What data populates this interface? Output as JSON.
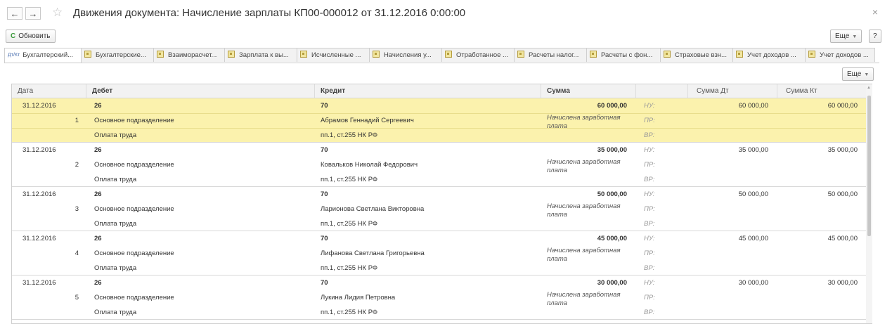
{
  "header": {
    "title": "Движения документа: Начисление зарплаты КП00-000012 от 31.12.2016 0:00:00",
    "back_label": "←",
    "forward_label": "→",
    "close_label": "×"
  },
  "toolbar": {
    "refresh_label": "Обновить",
    "more_label": "Еще",
    "help_label": "?"
  },
  "tabs": [
    {
      "label": "Бухгалтерский...",
      "icon": "accounting-icon"
    },
    {
      "label": "Бухгалтерские...",
      "icon": "register-icon"
    },
    {
      "label": "Взаиморасчет...",
      "icon": "register-icon"
    },
    {
      "label": "Зарплата к вы...",
      "icon": "register-icon"
    },
    {
      "label": "Исчисленные ...",
      "icon": "register-icon"
    },
    {
      "label": "Начисления у...",
      "icon": "register-icon"
    },
    {
      "label": "Отработанное ...",
      "icon": "register-icon"
    },
    {
      "label": "Расчеты налог...",
      "icon": "register-icon"
    },
    {
      "label": "Расчеты с фон...",
      "icon": "register-icon"
    },
    {
      "label": "Страховые взн...",
      "icon": "register-icon"
    },
    {
      "label": "Учет доходов ...",
      "icon": "register-icon"
    },
    {
      "label": "Учет доходов ...",
      "icon": "register-icon"
    }
  ],
  "table_toolbar": {
    "more_label": "Еще"
  },
  "columns": {
    "date": "Дата",
    "debit": "Дебет",
    "credit": "Кредит",
    "sum": "Сумма",
    "sum_dt": "Сумма Дт",
    "sum_kt": "Сумма Кт"
  },
  "rows": [
    {
      "date": "31.12.2016",
      "n": "1",
      "debit_acc": "26",
      "debit_sub1": "Основное подразделение",
      "debit_sub2": "Оплата труда",
      "credit_acc": "70",
      "credit_sub1": "Абрамов Геннадий Сергеевич",
      "credit_sub2": "пп.1, ст.255 НК РФ",
      "sum": "60 000,00",
      "content1": "Начислена заработная",
      "content2": "плата",
      "nu": "НУ:",
      "pr": "ПР:",
      "vr": "ВР:",
      "sum_dt": "60 000,00",
      "sum_kt": "60 000,00"
    },
    {
      "date": "31.12.2016",
      "n": "2",
      "debit_acc": "26",
      "debit_sub1": "Основное подразделение",
      "debit_sub2": "Оплата труда",
      "credit_acc": "70",
      "credit_sub1": "Ковальков Николай Федорович",
      "credit_sub2": "пп.1, ст.255 НК РФ",
      "sum": "35 000,00",
      "content1": "Начислена заработная",
      "content2": "плата",
      "nu": "НУ:",
      "pr": "ПР:",
      "vr": "ВР:",
      "sum_dt": "35 000,00",
      "sum_kt": "35 000,00"
    },
    {
      "date": "31.12.2016",
      "n": "3",
      "debit_acc": "26",
      "debit_sub1": "Основное подразделение",
      "debit_sub2": "Оплата труда",
      "credit_acc": "70",
      "credit_sub1": "Ларионова Светлана Викторовна",
      "credit_sub2": "пп.1, ст.255 НК РФ",
      "sum": "50 000,00",
      "content1": "Начислена заработная",
      "content2": "плата",
      "nu": "НУ:",
      "pr": "ПР:",
      "vr": "ВР:",
      "sum_dt": "50 000,00",
      "sum_kt": "50 000,00"
    },
    {
      "date": "31.12.2016",
      "n": "4",
      "debit_acc": "26",
      "debit_sub1": "Основное подразделение",
      "debit_sub2": "Оплата труда",
      "credit_acc": "70",
      "credit_sub1": "Лифанова Светлана Григорьевна",
      "credit_sub2": "пп.1, ст.255 НК РФ",
      "sum": "45 000,00",
      "content1": "Начислена заработная",
      "content2": "плата",
      "nu": "НУ:",
      "pr": "ПР:",
      "vr": "ВР:",
      "sum_dt": "45 000,00",
      "sum_kt": "45 000,00"
    },
    {
      "date": "31.12.2016",
      "n": "5",
      "debit_acc": "26",
      "debit_sub1": "Основное подразделение",
      "debit_sub2": "Оплата труда",
      "credit_acc": "70",
      "credit_sub1": "Лукина Лидия Петровна",
      "credit_sub2": "пп.1, ст.255 НК РФ",
      "sum": "30 000,00",
      "content1": "Начислена заработная",
      "content2": "плата",
      "nu": "НУ:",
      "pr": "ПР:",
      "vr": "ВР:",
      "sum_dt": "30 000,00",
      "sum_kt": "30 000,00"
    }
  ],
  "colors": {
    "selected_row": "#fbf2ad",
    "header_bg": "#f2f2f2",
    "refresh_icon": "#3a9a3a"
  }
}
